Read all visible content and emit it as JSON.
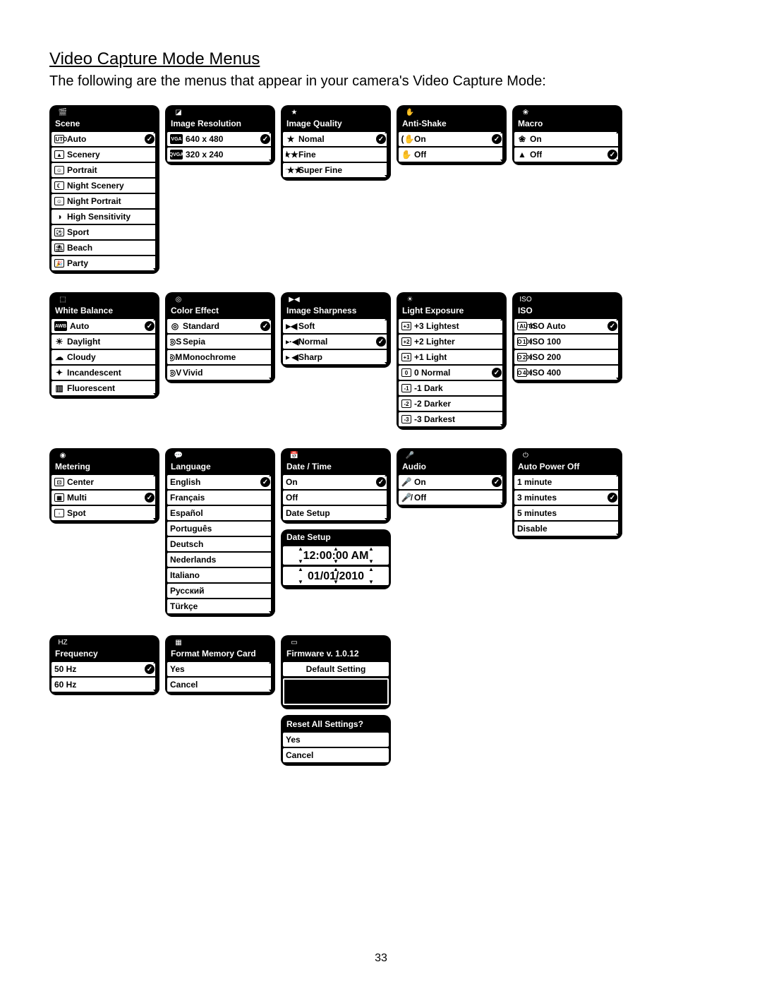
{
  "page": {
    "title": "Video Capture Mode Menus",
    "intro": "The following are the menus that appear in your camera's Video Capture Mode:",
    "page_number": "33"
  },
  "menus": {
    "scene": {
      "title": "Scene",
      "items": [
        {
          "icon": "AUTO",
          "iconStyle": "box",
          "label": "Auto",
          "checked": true
        },
        {
          "icon": "▲",
          "iconStyle": "box",
          "label": "Scenery"
        },
        {
          "icon": "☺",
          "iconStyle": "box",
          "label": "Portrait"
        },
        {
          "icon": "☾",
          "iconStyle": "box",
          "label": "Night Scenery"
        },
        {
          "icon": "☺",
          "iconStyle": "box",
          "label": "Night Portrait"
        },
        {
          "icon": "◑",
          "iconStyle": "sym",
          "label": "High Sensitivity"
        },
        {
          "icon": "⚽",
          "iconStyle": "box",
          "label": "Sport"
        },
        {
          "icon": "⛱",
          "iconStyle": "box",
          "label": "Beach"
        },
        {
          "icon": "🎉",
          "iconStyle": "box",
          "label": "Party"
        }
      ]
    },
    "image_resolution": {
      "title": "Image Resolution",
      "items": [
        {
          "icon": "VGA",
          "iconStyle": "text",
          "label": "640 x 480",
          "checked": true
        },
        {
          "icon": "QVGA",
          "iconStyle": "text",
          "label": "320 x 240"
        }
      ]
    },
    "image_quality": {
      "title": "Image Quality",
      "items": [
        {
          "icon": "★",
          "iconStyle": "sym",
          "label": "Nomal",
          "checked": true
        },
        {
          "icon": "★★",
          "iconStyle": "sym",
          "label": "Fine"
        },
        {
          "icon": "★★★",
          "iconStyle": "sym",
          "label": "Super Fine"
        }
      ]
    },
    "anti_shake": {
      "title": "Anti-Shake",
      "items": [
        {
          "icon": "((✋",
          "iconStyle": "sym",
          "label": "On",
          "checked": true
        },
        {
          "icon": "✋",
          "iconStyle": "sym",
          "label": "Off"
        }
      ]
    },
    "macro": {
      "title": "Macro",
      "items": [
        {
          "icon": "❀",
          "iconStyle": "sym",
          "label": "On"
        },
        {
          "icon": "▲",
          "iconStyle": "sym",
          "label": "Off",
          "checked": true
        }
      ]
    },
    "white_balance": {
      "title": "White Balance",
      "items": [
        {
          "icon": "AWB",
          "iconStyle": "text",
          "label": "Auto",
          "checked": true
        },
        {
          "icon": "☀",
          "iconStyle": "sym",
          "label": "Daylight"
        },
        {
          "icon": "☁",
          "iconStyle": "sym",
          "label": "Cloudy"
        },
        {
          "icon": "✦",
          "iconStyle": "sym",
          "label": "Incandescent"
        },
        {
          "icon": "▥",
          "iconStyle": "sym",
          "label": "Fluorescent"
        }
      ]
    },
    "color_effect": {
      "title": "Color Effect",
      "items": [
        {
          "icon": "◎",
          "iconStyle": "sym",
          "label": "Standard",
          "checked": true
        },
        {
          "icon": "◎S",
          "iconStyle": "sym",
          "label": "Sepia"
        },
        {
          "icon": "◎M",
          "iconStyle": "sym",
          "label": "Monochrome"
        },
        {
          "icon": "◎V",
          "iconStyle": "sym",
          "label": "Vivid"
        }
      ]
    },
    "image_sharpness": {
      "title": "Image Sharpness",
      "items": [
        {
          "icon": "▶◀",
          "iconStyle": "sym",
          "label": "Soft"
        },
        {
          "icon": "▶·◀",
          "iconStyle": "sym",
          "label": "Normal",
          "checked": true
        },
        {
          "icon": "▶ ◀",
          "iconStyle": "sym",
          "label": "Sharp"
        }
      ]
    },
    "light_exposure": {
      "title": "Light Exposure",
      "items": [
        {
          "icon": "+3",
          "iconStyle": "box",
          "label": "+3 Lightest"
        },
        {
          "icon": "+2",
          "iconStyle": "box",
          "label": "+2 Lighter"
        },
        {
          "icon": "+1",
          "iconStyle": "box",
          "label": "+1 Light"
        },
        {
          "icon": "0",
          "iconStyle": "box",
          "label": "0 Normal",
          "checked": true
        },
        {
          "icon": "-1",
          "iconStyle": "box",
          "label": "-1 Dark"
        },
        {
          "icon": "-2",
          "iconStyle": "box",
          "label": "-2 Darker"
        },
        {
          "icon": "-3",
          "iconStyle": "box",
          "label": "-3 Darkest"
        }
      ]
    },
    "iso": {
      "title": "ISO",
      "items": [
        {
          "icon": "ISO AUTO",
          "iconStyle": "box",
          "label": "ISO Auto",
          "checked": true
        },
        {
          "icon": "ISO 100",
          "iconStyle": "box",
          "label": "ISO 100"
        },
        {
          "icon": "ISO 200",
          "iconStyle": "box",
          "label": "ISO 200"
        },
        {
          "icon": "ISO 400",
          "iconStyle": "box",
          "label": "ISO 400"
        }
      ]
    },
    "metering": {
      "title": "Metering",
      "items": [
        {
          "icon": "⊡",
          "iconStyle": "box",
          "label": "Center"
        },
        {
          "icon": "▦",
          "iconStyle": "box",
          "label": "Multi",
          "checked": true
        },
        {
          "icon": "◦",
          "iconStyle": "box",
          "label": "Spot"
        }
      ]
    },
    "language": {
      "title": "Language",
      "items": [
        {
          "label": "English",
          "checked": true
        },
        {
          "label": "Français"
        },
        {
          "label": "Español"
        },
        {
          "label": "Português"
        },
        {
          "label": "Deutsch"
        },
        {
          "label": "Nederlands"
        },
        {
          "label": "Italiano"
        },
        {
          "label": "Русский"
        },
        {
          "label": "Türkçe"
        }
      ]
    },
    "date_time": {
      "title": "Date / Time",
      "items": [
        {
          "label": "On",
          "checked": true
        },
        {
          "label": "Off"
        },
        {
          "label": "Date Setup"
        }
      ]
    },
    "date_setup": {
      "title": "Date Setup",
      "time": "12:00:00 AM",
      "date": "01/01/2010"
    },
    "audio": {
      "title": "Audio",
      "items": [
        {
          "icon": "🎤",
          "iconStyle": "sym",
          "label": "On",
          "checked": true
        },
        {
          "icon": "🎤̸",
          "iconStyle": "sym",
          "label": "Off"
        }
      ]
    },
    "auto_power_off": {
      "title": "Auto Power Off",
      "items": [
        {
          "label": "1 minute"
        },
        {
          "label": "3 minutes",
          "checked": true
        },
        {
          "label": "5 minutes"
        },
        {
          "label": "Disable"
        }
      ]
    },
    "frequency": {
      "title": "Frequency",
      "items": [
        {
          "label": "50 Hz",
          "checked": true
        },
        {
          "label": "60 Hz"
        }
      ]
    },
    "format_memory": {
      "title": "Format Memory Card",
      "items": [
        {
          "label": "Yes"
        },
        {
          "label": "Cancel"
        }
      ]
    },
    "firmware": {
      "title": "Firmware v. 1.0.12",
      "default_setting": "Default Setting"
    },
    "reset_all": {
      "title": "Reset All Settings?",
      "items": [
        {
          "label": "Yes"
        },
        {
          "label": "Cancel"
        }
      ]
    }
  },
  "tab_icons": {
    "scene": "🎬",
    "image_resolution": "◪",
    "image_quality": "★",
    "anti_shake": "✋",
    "macro": "❀",
    "white_balance": "⬚",
    "color_effect": "◎",
    "image_sharpness": "▶◀",
    "light_exposure": "☀",
    "iso": "ISO",
    "metering": "◉",
    "language": "💬",
    "date_time": "📅",
    "audio": "🎤",
    "auto_power_off": "⏻",
    "frequency": "HZ",
    "format_memory": "▦",
    "firmware": "▭"
  }
}
